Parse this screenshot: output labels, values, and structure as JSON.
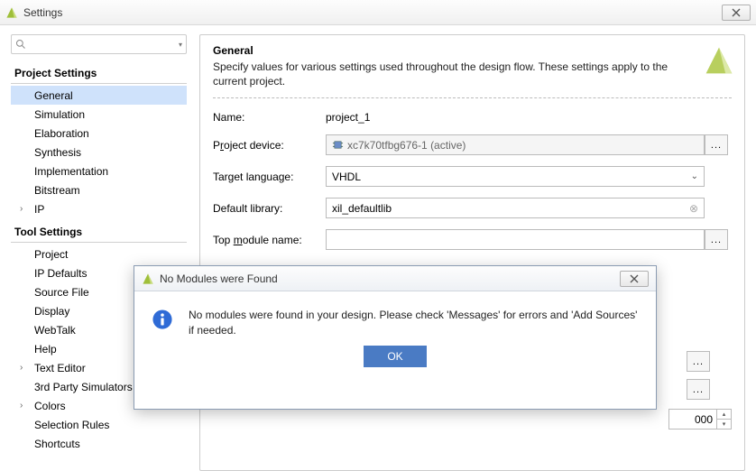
{
  "window": {
    "title": "Settings"
  },
  "search": {
    "placeholder": ""
  },
  "sidebar": {
    "groups": [
      {
        "title": "Project Settings",
        "items": [
          {
            "label": "General",
            "selected": true
          },
          {
            "label": "Simulation"
          },
          {
            "label": "Elaboration"
          },
          {
            "label": "Synthesis"
          },
          {
            "label": "Implementation"
          },
          {
            "label": "Bitstream"
          },
          {
            "label": "IP",
            "expandable": true
          }
        ]
      },
      {
        "title": "Tool Settings",
        "items": [
          {
            "label": "Project"
          },
          {
            "label": "IP Defaults"
          },
          {
            "label": "Source File"
          },
          {
            "label": "Display"
          },
          {
            "label": "WebTalk"
          },
          {
            "label": "Help"
          },
          {
            "label": "Text Editor",
            "expandable": true
          },
          {
            "label": "3rd Party Simulators"
          },
          {
            "label": "Colors",
            "expandable": true
          },
          {
            "label": "Selection Rules"
          },
          {
            "label": "Shortcuts"
          }
        ]
      }
    ]
  },
  "panel": {
    "title": "General",
    "desc": "Specify values for various settings used throughout the design flow. These settings apply to the current project.",
    "name_label": "Name:",
    "name_value": "project_1",
    "device_label_pre": "P",
    "device_label_u": "r",
    "device_label_post": "oject device:",
    "device_value": "xc7k70tfbg676-1 (active)",
    "lang_label_pre": "Tar",
    "lang_label_u": "g",
    "lang_label_post": "et language:",
    "lang_value": "VHDL",
    "lib_label": "Default library:",
    "lib_value": "xil_defaultlib",
    "top_label_pre": "Top ",
    "top_label_u": "m",
    "top_label_post": "odule name:",
    "top_value": "",
    "dots": "...",
    "num_value": "000"
  },
  "modal": {
    "title": "No Modules were Found",
    "message": "No modules were found in your design. Please check 'Messages' for errors and 'Add Sources' if needed.",
    "ok": "OK"
  }
}
